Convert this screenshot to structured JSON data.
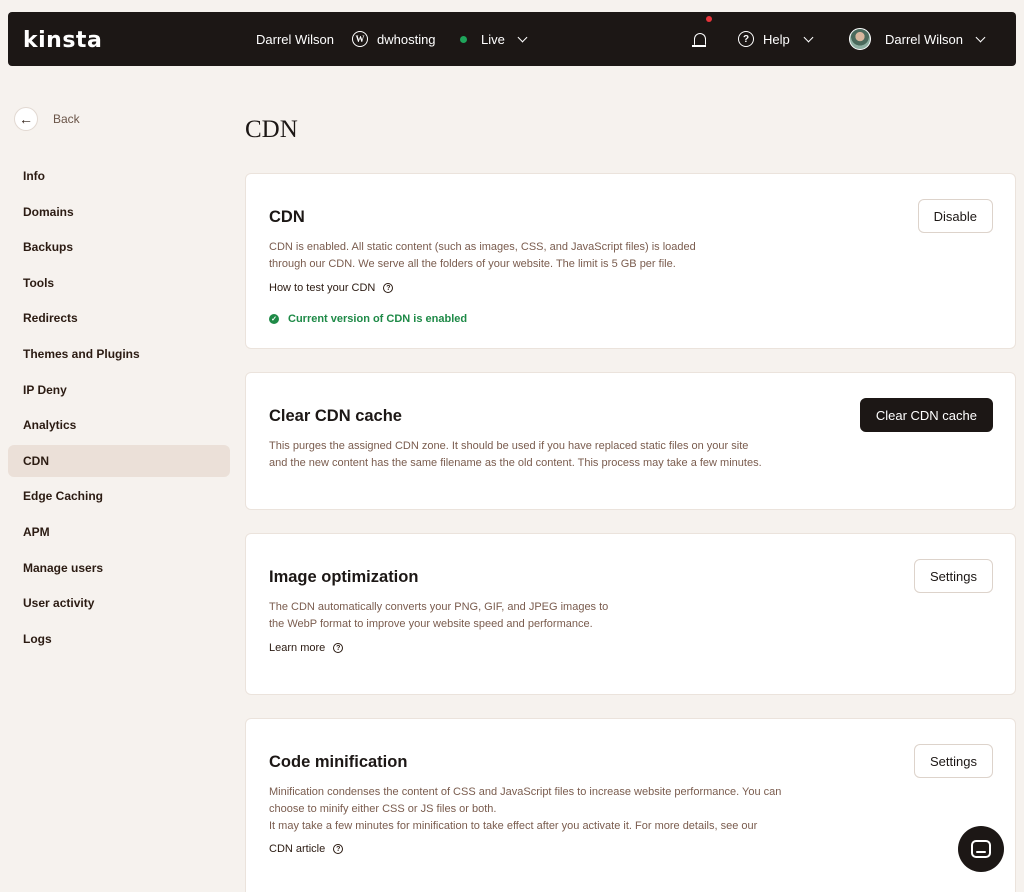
{
  "topbar": {
    "logo": "kinsta",
    "user_name": "Darrel Wilson",
    "site_name": "dwhosting",
    "environment": "Live",
    "help_label": "Help",
    "account_name": "Darrel Wilson",
    "live_color": "#1fa55b",
    "notification_dot_color": "#e8343a"
  },
  "sidebar": {
    "back_label": "Back",
    "items": [
      {
        "label": "Info"
      },
      {
        "label": "Domains"
      },
      {
        "label": "Backups"
      },
      {
        "label": "Tools"
      },
      {
        "label": "Redirects"
      },
      {
        "label": "Themes and Plugins"
      },
      {
        "label": "IP Deny"
      },
      {
        "label": "Analytics"
      },
      {
        "label": "CDN",
        "active": true
      },
      {
        "label": "Edge Caching"
      },
      {
        "label": "APM"
      },
      {
        "label": "Manage users"
      },
      {
        "label": "User activity"
      },
      {
        "label": "Logs"
      }
    ]
  },
  "main": {
    "title": "CDN",
    "cards": {
      "cdn": {
        "title": "CDN",
        "desc_line1": "CDN is enabled. All static content (such as images, CSS, and JavaScript files) is loaded",
        "desc_line2": "through our CDN. We serve all the folders of your website. The limit is 5 GB per file.",
        "link": "How to test your CDN",
        "status": "Current version of CDN is enabled",
        "button": "Disable"
      },
      "clear_cache": {
        "title": "Clear CDN cache",
        "desc_line1": "This purges the assigned CDN zone. It should be used if you have replaced static files on your site",
        "desc_line2": "and the new content has the same filename as the old content. This process may take a few minutes.",
        "button": "Clear CDN cache"
      },
      "image_opt": {
        "title": "Image optimization",
        "desc_line1": "The CDN automatically converts your PNG, GIF, and JPEG images to",
        "desc_line2": "the WebP format to improve your website speed and performance.",
        "link": "Learn more",
        "button": "Settings"
      },
      "code_min": {
        "title": "Code minification",
        "desc_line1": "Minification condenses the content of CSS and JavaScript files to increase website performance. You can",
        "desc_line2": "choose to minify either CSS or JS files or both.",
        "desc_line3": "It may take a few minutes for minification to take effect after you activate it. For more details, see our",
        "link": "CDN article",
        "button": "Settings"
      }
    },
    "status_color": "#1e8a47"
  }
}
